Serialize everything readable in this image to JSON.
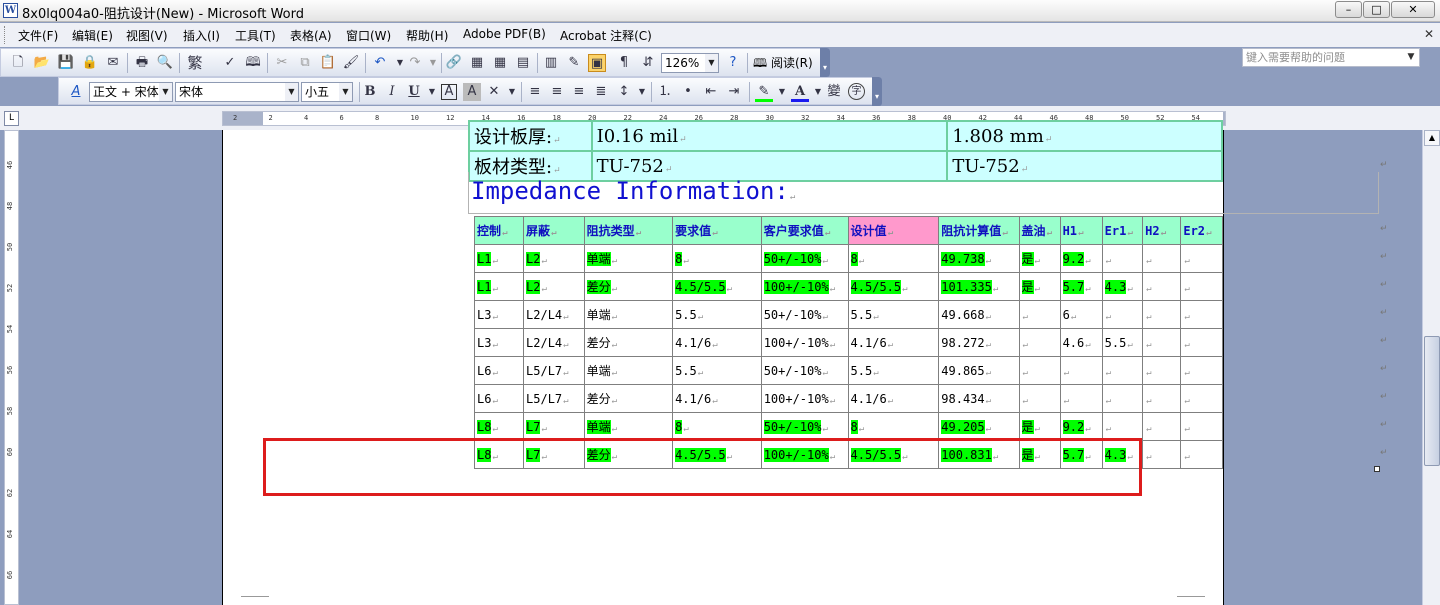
{
  "window": {
    "title": "8x0lq004a0-阻抗设计(New) - Microsoft Word",
    "icon": "W",
    "buttons": {
      "minimize": "–",
      "maximize": "□",
      "close": "✕"
    }
  },
  "menu": {
    "items": [
      "文件(F)",
      "编辑(E)",
      "视图(V)",
      "插入(I)",
      "工具(T)",
      "表格(A)",
      "窗口(W)",
      "帮助(H)",
      "Adobe PDF(B)",
      "Acrobat 注释(C)"
    ],
    "help_placeholder": "键入需要帮助的问题",
    "close_doc": "✕"
  },
  "toolbar1": {
    "icons": {
      "new": "🗋",
      "open": "📂",
      "save": "💾",
      "permission": "🔒",
      "email": "✉",
      "print": "🖶",
      "preview": "🔍",
      "traditional": "繁",
      "spell": "✓",
      "research": "🕮",
      "cut": "✂",
      "copy": "⧉",
      "paste": "📋",
      "format_painter": "🖌",
      "undo": "↶",
      "redo": "↷",
      "hyperlink": "🔗",
      "tables_borders": "▦",
      "insert_table": "▦",
      "insert_excel": "▤",
      "columns": "▥",
      "drawing": "✎",
      "doc_map": "▣",
      "show_para": "¶"
    },
    "zoom": "126%",
    "read_label": "阅读(R)"
  },
  "toolbar2": {
    "styles_icon": "A",
    "style": "正文 + 宋体",
    "font": "宋体",
    "size": "小五",
    "bold": "B",
    "italic": "I",
    "underline": "U",
    "border_char": "A",
    "shade_char": "A",
    "scale_char": "✕",
    "highlight_color": "#00ff00",
    "font_color": "#1a1af0",
    "phonetic": "變",
    "enclose": "字"
  },
  "ruler": {
    "corner": "L",
    "h_ticks": [
      "2",
      "2",
      "4",
      "6",
      "8",
      "10",
      "12",
      "14",
      "16",
      "18",
      "20",
      "22",
      "24",
      "26",
      "28",
      "30",
      "32",
      "34",
      "36",
      "38",
      "40",
      "42",
      "44",
      "46",
      "48",
      "50",
      "52",
      "54"
    ],
    "v_ticks": [
      "46",
      "48",
      "50",
      "52",
      "54",
      "56",
      "58",
      "60",
      "62",
      "64",
      "66"
    ]
  },
  "doc": {
    "prev_table": {
      "rows": [
        [
          "设计板厚:",
          "I0.16 mil",
          "1.808 mm"
        ],
        [
          "板材类型:",
          "TU-752",
          "TU-752"
        ]
      ]
    },
    "heading": "Impedance Information:",
    "table": {
      "headers": [
        "控制",
        "屏蔽",
        "阻抗类型",
        "要求值",
        "客户要求值",
        "设计值",
        "阻抗计算值",
        "盖油",
        "H1",
        "Er1",
        "H2",
        "Er2"
      ],
      "rows": [
        {
          "cells": [
            "L1",
            "L2",
            "单端",
            "8",
            "50+/-10%",
            "8",
            "49.738",
            "是",
            "9.2",
            "",
            "",
            ""
          ],
          "hl": true
        },
        {
          "cells": [
            "L1",
            "L2",
            "差分",
            "4.5/5.5",
            "100+/-10%",
            "4.5/5.5",
            "101.335",
            "是",
            "5.7",
            "4.3",
            "",
            ""
          ],
          "hl": true
        },
        {
          "cells": [
            "L3",
            "L2/L4",
            "单端",
            "5.5",
            "50+/-10%",
            "5.5",
            "49.668",
            "",
            "6",
            "",
            "",
            ""
          ],
          "hl": false
        },
        {
          "cells": [
            "L3",
            "L2/L4",
            "差分",
            "4.1/6",
            "100+/-10%",
            "4.1/6",
            "98.272",
            "",
            "4.6",
            "5.5",
            "",
            ""
          ],
          "hl": false
        },
        {
          "cells": [
            "L6",
            "L5/L7",
            "单端",
            "5.5",
            "50+/-10%",
            "5.5",
            "49.865",
            "",
            "",
            "",
            "",
            ""
          ],
          "hl": false
        },
        {
          "cells": [
            "L6",
            "L5/L7",
            "差分",
            "4.1/6",
            "100+/-10%",
            "4.1/6",
            "98.434",
            "",
            "",
            "",
            "",
            ""
          ],
          "hl": false
        },
        {
          "cells": [
            "L8",
            "L7",
            "单端",
            "8",
            "50+/-10%",
            "8",
            "49.205",
            "是",
            "9.2",
            "",
            "",
            ""
          ],
          "hl": true
        },
        {
          "cells": [
            "L8",
            "L7",
            "差分",
            "4.5/5.5",
            "100+/-10%",
            "4.5/5.5",
            "100.831",
            "是",
            "5.7",
            "4.3",
            "",
            ""
          ],
          "hl": true
        }
      ]
    }
  },
  "colors": {
    "header_green": "#99ffcc",
    "header_pink": "#ff99cc",
    "highlight": "#00ff00",
    "annotation_red": "#dd1c1c",
    "prev_table_bg": "#ccffff"
  }
}
